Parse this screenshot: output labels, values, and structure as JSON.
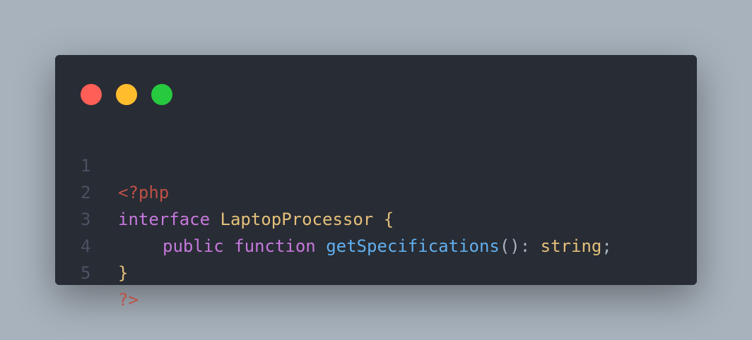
{
  "colors": {
    "background": "#a8b2bc",
    "editor": "#282c34",
    "line_number": "#4b5263",
    "keyword": "#c678dd",
    "php_tag": "#be5046",
    "type_name": "#e5c07b",
    "function_name": "#61afef",
    "punctuation": "#abb2bf",
    "dot_close": "#ff5f56",
    "dot_minimize": "#ffbd2e",
    "dot_maximize": "#27c93f"
  },
  "window_controls": [
    "close",
    "minimize",
    "maximize"
  ],
  "code": {
    "language": "php",
    "lines": [
      {
        "number": "1",
        "tokens": [
          {
            "text": "<?php",
            "kind": "php_tag"
          }
        ]
      },
      {
        "number": "2",
        "tokens": [
          {
            "text": "interface",
            "kind": "keyword"
          },
          {
            "text": " ",
            "kind": "punctuation"
          },
          {
            "text": "LaptopProcessor",
            "kind": "type_name"
          },
          {
            "text": " ",
            "kind": "punctuation"
          },
          {
            "text": "{",
            "kind": "type_name"
          }
        ]
      },
      {
        "number": "3",
        "indent": true,
        "tokens": [
          {
            "text": "public",
            "kind": "keyword"
          },
          {
            "text": " ",
            "kind": "punctuation"
          },
          {
            "text": "function",
            "kind": "keyword"
          },
          {
            "text": " ",
            "kind": "punctuation"
          },
          {
            "text": "getSpecifications",
            "kind": "function_name"
          },
          {
            "text": "():",
            "kind": "punctuation"
          },
          {
            "text": " ",
            "kind": "punctuation"
          },
          {
            "text": "string",
            "kind": "type_name"
          },
          {
            "text": ";",
            "kind": "punctuation"
          }
        ]
      },
      {
        "number": "4",
        "tokens": [
          {
            "text": "}",
            "kind": "type_name"
          }
        ]
      },
      {
        "number": "5",
        "tokens": [
          {
            "text": "?>",
            "kind": "php_tag"
          }
        ]
      }
    ]
  }
}
